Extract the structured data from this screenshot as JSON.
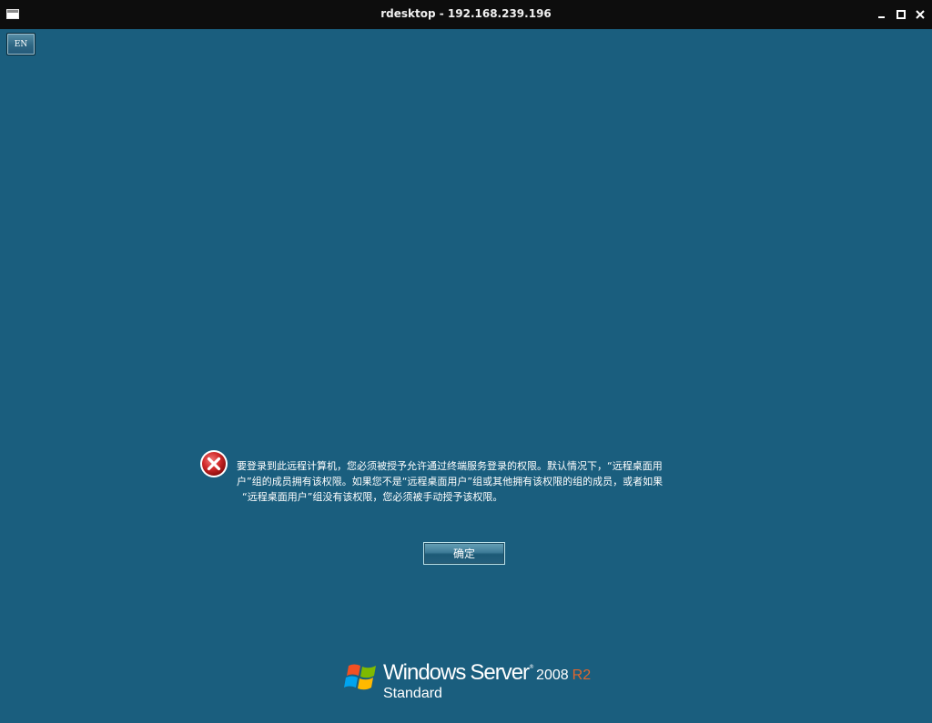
{
  "window": {
    "title": "rdesktop - 192.168.239.196",
    "icon": "window-icon",
    "controls": [
      "minimize-icon",
      "maximize-icon",
      "close-icon"
    ]
  },
  "screen": {
    "background_color": "#1a5e7e",
    "language_button": "EN",
    "dialog": {
      "icon": "error-icon",
      "message_lines": [
        "要登录到此远程计算机，您必须被授予允许通过终端服务登录的权限。默认情况下，“远程桌面用",
        "户”组的成员拥有该权限。如果您不是“远程桌面用户”组或其他拥有该权限的组的成员，或者如果",
        "“远程桌面用户”组没有该权限，您必须被手动授予该权限。"
      ],
      "ok_button": "确定"
    },
    "branding": {
      "logo": "windows-flag-logo",
      "windows": "Windows",
      "server": "Server",
      "trademark": "®",
      "year": "2008",
      "release": "R2",
      "edition": "Standard",
      "release_color": "#e0662c"
    }
  }
}
